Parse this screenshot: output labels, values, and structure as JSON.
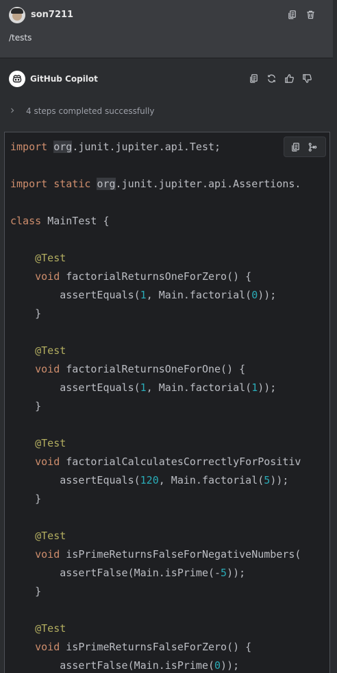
{
  "user_message": {
    "username": "son7211",
    "text": "/tests",
    "icons": [
      "copy-icon",
      "trash-icon"
    ]
  },
  "assistant": {
    "name": "GitHub Copilot",
    "icons": [
      "copy-icon",
      "regenerate-icon",
      "thumbs-up-icon",
      "thumbs-down-icon"
    ],
    "steps_text": "4 steps completed successfully"
  },
  "code_block": {
    "toolbar_icons": [
      "copy-icon",
      "insert-into-file-icon"
    ],
    "lines": [
      [
        [
          "kw",
          "import "
        ],
        [
          "hl",
          "org"
        ],
        [
          "",
          "."
        ],
        [
          "",
          "junit.jupiter.api.Test;"
        ]
      ],
      [],
      [
        [
          "kw",
          "import static "
        ],
        [
          "hl",
          "org"
        ],
        [
          "",
          ".junit.jupiter.api.Assertions."
        ]
      ],
      [],
      [
        [
          "kw",
          "class "
        ],
        [
          "",
          "MainTest {"
        ]
      ],
      [],
      [
        [
          "",
          "    "
        ],
        [
          "an",
          "@Test"
        ]
      ],
      [
        [
          "",
          "    "
        ],
        [
          "kw",
          "void "
        ],
        [
          "",
          "factorialReturnsOneForZero() {"
        ]
      ],
      [
        [
          "",
          "        assertEquals("
        ],
        [
          "num",
          "1"
        ],
        [
          "",
          ", Main.factorial("
        ],
        [
          "num",
          "0"
        ],
        [
          "",
          "));"
        ]
      ],
      [
        [
          "",
          "    }"
        ]
      ],
      [],
      [
        [
          "",
          "    "
        ],
        [
          "an",
          "@Test"
        ]
      ],
      [
        [
          "",
          "    "
        ],
        [
          "kw",
          "void "
        ],
        [
          "",
          "factorialReturnsOneForOne() {"
        ]
      ],
      [
        [
          "",
          "        assertEquals("
        ],
        [
          "num",
          "1"
        ],
        [
          "",
          ", Main.factorial("
        ],
        [
          "num",
          "1"
        ],
        [
          "",
          "));"
        ]
      ],
      [
        [
          "",
          "    }"
        ]
      ],
      [],
      [
        [
          "",
          "    "
        ],
        [
          "an",
          "@Test"
        ]
      ],
      [
        [
          "",
          "    "
        ],
        [
          "kw",
          "void "
        ],
        [
          "",
          "factorialCalculatesCorrectlyForPositiv"
        ]
      ],
      [
        [
          "",
          "        assertEquals("
        ],
        [
          "num",
          "120"
        ],
        [
          "",
          ", Main.factorial("
        ],
        [
          "num",
          "5"
        ],
        [
          "",
          "));"
        ]
      ],
      [
        [
          "",
          "    }"
        ]
      ],
      [],
      [
        [
          "",
          "    "
        ],
        [
          "an",
          "@Test"
        ]
      ],
      [
        [
          "",
          "    "
        ],
        [
          "kw",
          "void "
        ],
        [
          "",
          "isPrimeReturnsFalseForNegativeNumbers("
        ]
      ],
      [
        [
          "",
          "        assertFalse(Main.isPrime(-"
        ],
        [
          "num",
          "5"
        ],
        [
          "",
          "));"
        ]
      ],
      [
        [
          "",
          "    }"
        ]
      ],
      [],
      [
        [
          "",
          "    "
        ],
        [
          "an",
          "@Test"
        ]
      ],
      [
        [
          "",
          "    "
        ],
        [
          "kw",
          "void "
        ],
        [
          "",
          "isPrimeReturnsFalseForZero() {"
        ]
      ],
      [
        [
          "",
          "        assertFalse(Main.isPrime("
        ],
        [
          "num",
          "0"
        ],
        [
          "",
          "));"
        ]
      ]
    ]
  }
}
